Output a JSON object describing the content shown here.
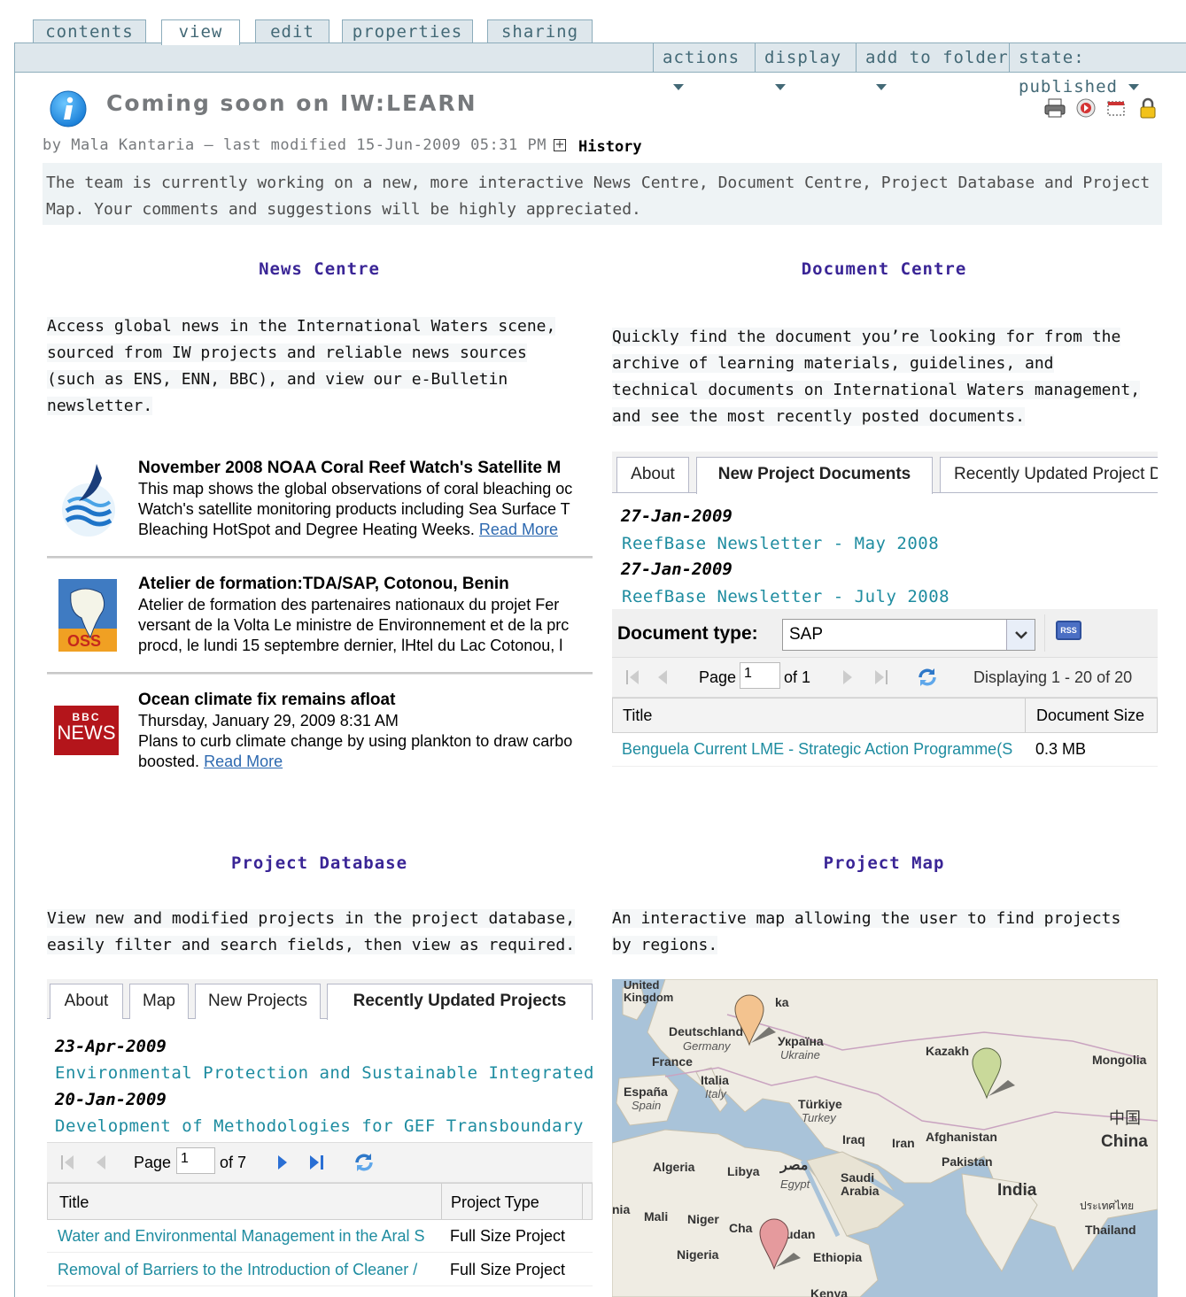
{
  "tabs": [
    "contents",
    "view",
    "edit",
    "properties",
    "sharing"
  ],
  "actions": {
    "actions": "actions",
    "display": "display",
    "add_to_folder": "add to folder",
    "state": "state: published"
  },
  "page": {
    "title": "Coming soon on IW:LEARN",
    "byline": "by Mala Kantaria — last modified 15-Jun-2009 05:31 PM",
    "history": "History",
    "description": "The team is currently working on a new, more interactive News Centre, Document Centre, Project Database and Project Map. Your comments and suggestions will be highly appreciated."
  },
  "news_centre": {
    "heading": "News Centre",
    "intro": "Access global news in the International Waters scene, sourced from IW projects and reliable news sources (such as ENS, ENN, BBC), and view our e-Bulletin newsletter.",
    "items": [
      {
        "title": "November 2008 NOAA Coral Reef Watch's Satellite M",
        "lines": [
          "This map shows the global observations of coral bleaching oc",
          "Watch's satellite monitoring products including Sea Surface T"
        ],
        "last": "Bleaching HotSpot and Degree Heating Weeks.",
        "read_more": "Read More",
        "logo": "noaa-logo"
      },
      {
        "title": "Atelier de formation:TDA/SAP, Cotonou, Benin",
        "lines": [
          "Atelier de formation des partenaires nationaux du projet Fer",
          "versant de la Volta Le ministre de Environnement et de la prc",
          "procd, le lundi 15 septembre dernier, lHtel du Lac Cotonou, l"
        ],
        "last": "",
        "read_more": "",
        "logo": "oss-logo",
        "logo_text": "OSS"
      },
      {
        "title": "Ocean climate fix remains afloat",
        "lines": [
          "Thursday, January 29, 2009 8:31 AM",
          "Plans to curb climate change by using plankton to draw carbo"
        ],
        "last": "boosted.",
        "read_more": "Read More",
        "logo": "bbc-news-logo",
        "logo_text_top": "BBC",
        "logo_text": "NEWS"
      }
    ]
  },
  "document_centre": {
    "heading": "Document Centre",
    "intro": "Quickly find the document you’re looking for from the archive of learning materials, guidelines, and technical documents on International Waters management, and see the most recently posted documents.",
    "tabs": [
      "About",
      "New Project Documents",
      "Recently Updated Project D"
    ],
    "entries": [
      {
        "date": "27-Jan-2009",
        "title": "ReefBase Newsletter - May 2008"
      },
      {
        "date": "27-Jan-2009",
        "title": "ReefBase Newsletter - July 2008"
      }
    ],
    "doc_type_label": "Document type:",
    "doc_type_value": "SAP",
    "rss": "RSS",
    "pager": {
      "page_label": "Page",
      "page": "1",
      "of": "of 1",
      "displaying": "Displaying 1 - 20 of 20"
    },
    "columns": [
      "Title",
      "Document Size"
    ],
    "rows": [
      {
        "title": "Benguela Current LME - Strategic Action Programme(S",
        "size": "0.3 MB"
      }
    ]
  },
  "project_database": {
    "heading": "Project Database",
    "intro": "View new and modified projects in the project database, easily filter and search fields, then view as required.",
    "tabs": [
      "About",
      "Map",
      "New Projects",
      "Recently Updated Projects"
    ],
    "entries": [
      {
        "date": "23-Apr-2009",
        "title": "Environmental Protection and Sustainable Integrated Manag"
      },
      {
        "date": "20-Jan-2009",
        "title": "Development of Methodologies for GEF Transboundary Wate"
      }
    ],
    "pager": {
      "page_label": "Page",
      "page": "1",
      "of": "of 7"
    },
    "columns": [
      "Title",
      "Project Type"
    ],
    "rows": [
      {
        "title": "Water and Environmental Management in the Aral S",
        "type": "Full Size Project"
      },
      {
        "title": "Removal of Barriers to the Introduction of Cleaner /",
        "type": "Full Size Project"
      }
    ]
  },
  "project_map": {
    "heading": "Project Map",
    "intro": "An interactive map allowing the user to find projects by regions.",
    "labels": {
      "uk": "United Kingdom",
      "de": "Deutschland",
      "de_sub": "Germany",
      "ua": "Україна",
      "ua_sub": "Ukraine",
      "fr": "France",
      "kz": "Kazakh",
      "mn": "Mongolia",
      "it": "Italia",
      "it_sub": "Italy",
      "es": "España",
      "es_sub": "Spain",
      "tr": "Türkiye",
      "tr_sub": "Turkey",
      "cn_local": "中国",
      "cn": "China",
      "iq": "Iraq",
      "ir": "Iran",
      "af": "Afghanistan",
      "pk": "Pakistan",
      "dz": "Algeria",
      "ly": "Libya",
      "eg_local": "مصر",
      "eg": "Egypt",
      "sa": "Saudi Arabia",
      "in": "India",
      "th_local": "ประเทศไทย",
      "th": "Thailand",
      "ml": "Mali",
      "ne": "Niger",
      "td": "Cha",
      "sd": "udan",
      "ng": "Nigeria",
      "et": "Ethiopia",
      "ke": "Kenya",
      "ka": "ka",
      "nia": "nia"
    },
    "colors": {
      "water": "#a9c3d9",
      "land": "#efece3",
      "marker_orange": "#f3c38f",
      "marker_green": "#c9d99a",
      "marker_red": "#e59a9d"
    }
  }
}
